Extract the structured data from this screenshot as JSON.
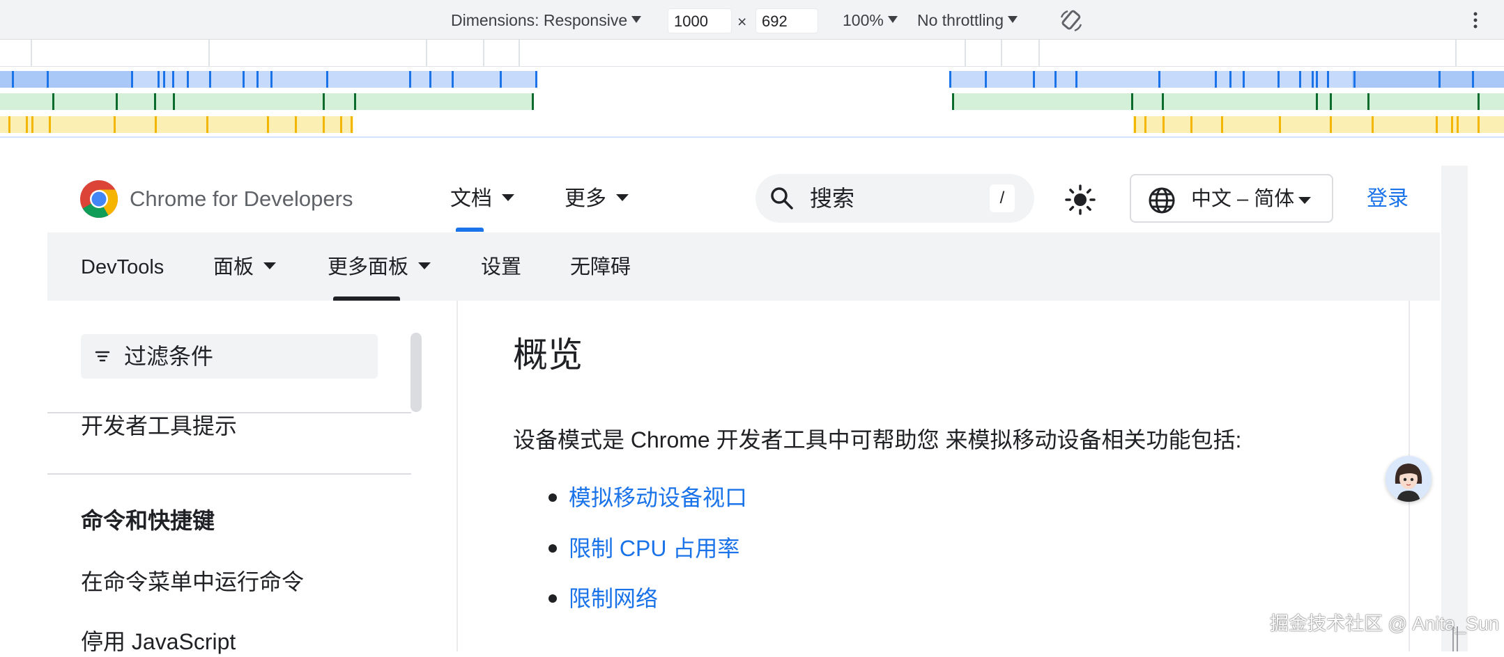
{
  "devtools_toolbar": {
    "dimensions_label": "Dimensions: Responsive",
    "width_value": "1000",
    "times": "×",
    "height_value": "692",
    "zoom": "100%",
    "throttling": "No throttling",
    "rotate_icon": "rotate-icon",
    "more_icon": "vertical-dots-icon"
  },
  "colors": {
    "blue_track": "#c6dafc",
    "blue_tick": "#1a73e8",
    "green_track": "#d4f0d9",
    "green_tick": "#0b6b2d",
    "yellow_track": "#fcefb4",
    "yellow_tick": "#f2b600",
    "link": "#1a73e8"
  },
  "header": {
    "site_name": "Chrome for Developers",
    "nav": [
      {
        "label": "文档"
      },
      {
        "label": "更多"
      }
    ],
    "search": {
      "placeholder": "搜索",
      "shortcut": "/"
    },
    "theme_icon": "brightness-icon",
    "language": "中文 – 简体",
    "login": "登录"
  },
  "subnav": {
    "items": [
      {
        "label": "DevTools"
      },
      {
        "label": "面板"
      },
      {
        "label": "更多面板"
      },
      {
        "label": "设置"
      },
      {
        "label": "无障碍"
      }
    ]
  },
  "sidebar": {
    "filter_placeholder": "过滤条件",
    "items": [
      {
        "label": "开发者工具提示"
      },
      {
        "label": "命令和快捷键"
      },
      {
        "label": "在命令菜单中运行命令"
      },
      {
        "label": "停用 JavaScript"
      }
    ]
  },
  "main": {
    "title": "概览",
    "paragraph": "设备模式是 Chrome 开发者工具中可帮助您 来模拟移动设备相关功能包括:",
    "links": [
      {
        "label": "模拟移动设备视口"
      },
      {
        "label": "限制 CPU 占用率"
      },
      {
        "label": "限制网络"
      }
    ]
  },
  "watermark": "掘金技术社区 @ Anita_Sun"
}
